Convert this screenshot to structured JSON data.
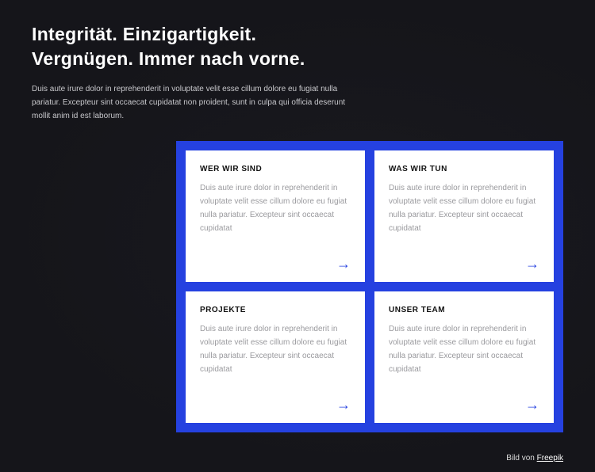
{
  "header": {
    "title": "Integrität. Einzigartigkeit. Vergnügen. Immer nach vorne.",
    "intro": "Duis aute irure dolor in reprehenderit in voluptate velit esse cillum dolore eu fugiat nulla pariatur. Excepteur sint occaecat cupidatat non proident, sunt in culpa qui officia deserunt mollit anim id est laborum."
  },
  "cards": [
    {
      "title": "WER WIR SIND",
      "body": "Duis aute irure dolor in reprehenderit in voluptate velit esse cillum dolore eu fugiat nulla pariatur. Excepteur sint occaecat cupidatat"
    },
    {
      "title": "WAS WIR TUN",
      "body": "Duis aute irure dolor in reprehenderit in voluptate velit esse cillum dolore eu fugiat nulla pariatur. Excepteur sint occaecat cupidatat"
    },
    {
      "title": "PROJEKTE",
      "body": "Duis aute irure dolor in reprehenderit in voluptate velit esse cillum dolore eu fugiat nulla pariatur. Excepteur sint occaecat cupidatat"
    },
    {
      "title": "UNSER TEAM",
      "body": "Duis aute irure dolor in reprehenderit in voluptate velit esse cillum dolore eu fugiat nulla pariatur. Excepteur sint occaecat cupidatat"
    }
  ],
  "credit": {
    "label": "Bild von",
    "link": "Freepik"
  },
  "colors": {
    "accent": "#2541e0"
  }
}
